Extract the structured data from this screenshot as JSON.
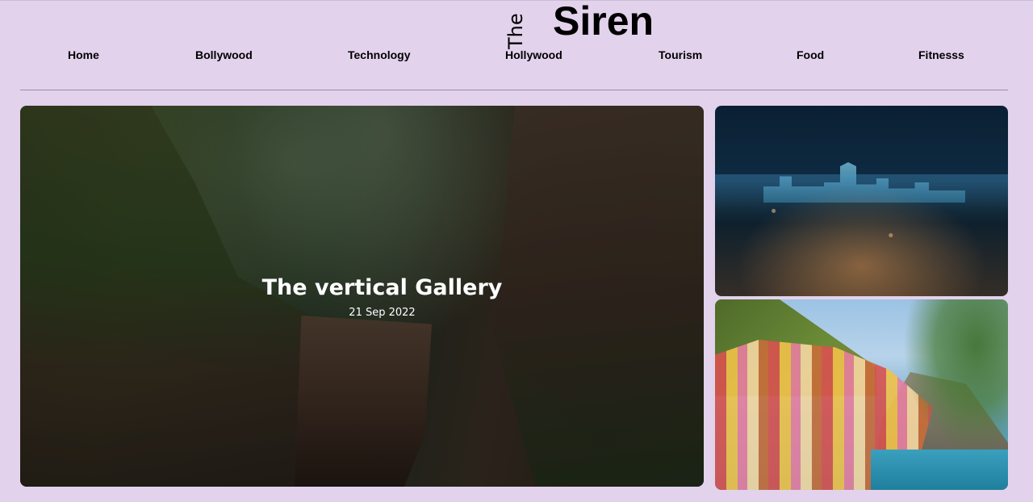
{
  "site": {
    "logo_prefix": "The",
    "logo_name": "Siren"
  },
  "nav": {
    "items": [
      {
        "label": "Home"
      },
      {
        "label": "Bollywood"
      },
      {
        "label": "Technology"
      },
      {
        "label": "Hollywood"
      },
      {
        "label": "Tourism"
      },
      {
        "label": "Food"
      },
      {
        "label": "Fitnesss"
      }
    ]
  },
  "hero": {
    "title": "The vertical Gallery",
    "date": "21 Sep 2022"
  },
  "theme": {
    "background": "#e2d2ec",
    "text": "#000000",
    "divider": "#9a8fa0"
  }
}
